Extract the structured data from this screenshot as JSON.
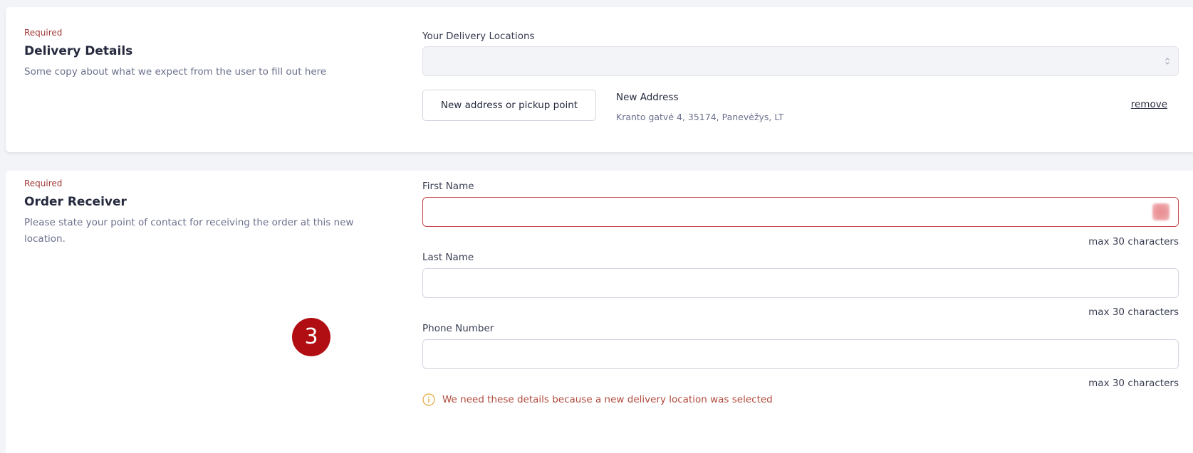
{
  "delivery_section": {
    "required_label": "Required",
    "title": "Delivery Details",
    "description": "Some copy about what we expect from the user to fill out here",
    "locations_label": "Your Delivery Locations",
    "locations_value": "",
    "new_address_button": "New address or pickup point",
    "selected_address": {
      "title": "New Address",
      "line": "Kranto gatvė 4, 35174, Panevėžys, LT",
      "remove_label": "remove"
    }
  },
  "receiver_section": {
    "required_label": "Required",
    "title": "Order Receiver",
    "description": "Please state your point of contact for receiving the order at this new location.",
    "fields": [
      {
        "label": "First Name",
        "value": "",
        "hint": "max 30 characters",
        "state": "error"
      },
      {
        "label": "Last Name",
        "value": "",
        "hint": "max 30 characters",
        "state": "default"
      },
      {
        "label": "Phone Number",
        "value": "",
        "hint": "max 30 characters",
        "state": "default"
      }
    ],
    "notice": "We need these details because a new delivery location was selected"
  },
  "step_badge": "3",
  "colors": {
    "required": "#a23a3a",
    "error_border": "#c8484d",
    "notice_text": "#b04a3c",
    "notice_icon": "#e0a53a",
    "badge": "#b00e12",
    "page_background": "#f3f4f8"
  },
  "icons": {
    "select_arrows": "chevron-up-down-icon",
    "notice": "info-circle-icon",
    "autofill": "autofill-icon"
  }
}
